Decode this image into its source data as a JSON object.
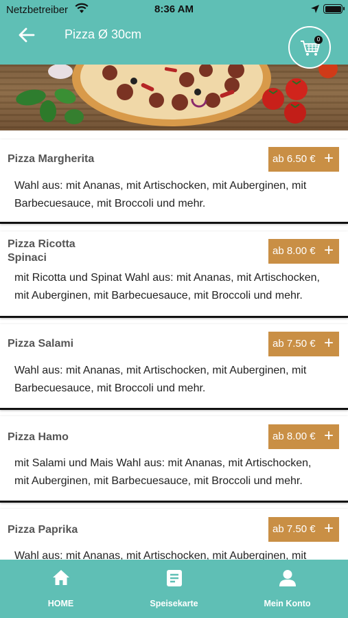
{
  "status_bar": {
    "carrier": "Netzbetreiber",
    "time": "8:36 AM"
  },
  "header": {
    "title": "Pizza Ø 30cm",
    "cart_count": "0"
  },
  "items": [
    {
      "name": "Pizza Margherita",
      "price": "ab 6.50 €",
      "desc_lines": [
        "Wahl aus: mit Ananas, mit Artischocken, mit Auberginen, mit",
        "Barbecuesauce, mit Broccoli und mehr."
      ]
    },
    {
      "name_lines": [
        "Pizza Ricotta",
        "Spinaci"
      ],
      "price": "ab 8.00 €",
      "desc_lines": [
        "mit Ricotta und Spinat Wahl aus: mit Ananas, mit Artischocken,",
        "mit Auberginen, mit Barbecuesauce, mit Broccoli und mehr."
      ]
    },
    {
      "name": "Pizza Salami",
      "price": "ab 7.50 €",
      "desc_lines": [
        "Wahl aus: mit Ananas, mit Artischocken, mit Auberginen, mit",
        "Barbecuesauce, mit Broccoli und mehr."
      ]
    },
    {
      "name": "Pizza Hamo",
      "price": "ab 8.00 €",
      "desc_lines": [
        "mit Salami und Mais Wahl aus: mit Ananas, mit Artischocken,",
        "mit Auberginen, mit Barbecuesauce, mit Broccoli und mehr."
      ]
    },
    {
      "name": "Pizza Paprika",
      "price": "ab 7.50 €",
      "desc_lines": [
        "Wahl aus: mit Ananas, mit Artischocken, mit Auberginen, mit"
      ]
    }
  ],
  "add_symbol": "+",
  "bottom_nav": [
    {
      "label": "HOME",
      "icon": "home-icon"
    },
    {
      "label": "Speisekarte",
      "icon": "menu-card-icon"
    },
    {
      "label": "Mein Konto",
      "icon": "user-icon"
    }
  ],
  "colors": {
    "accent": "#5fbfb5",
    "price_button": "#c98f45"
  }
}
